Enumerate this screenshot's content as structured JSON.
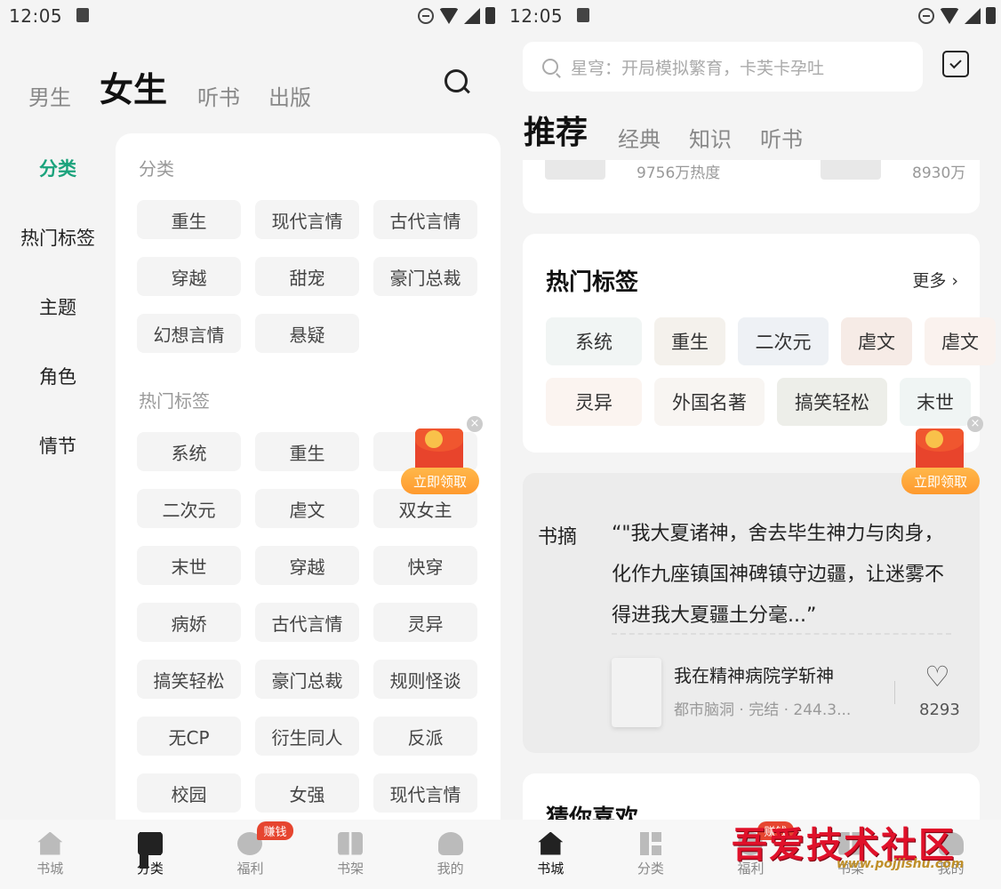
{
  "status_bar": {
    "time": "12:05"
  },
  "left": {
    "top_tabs": [
      "男生",
      "女生",
      "听书",
      "出版"
    ],
    "sidebar": [
      "分类",
      "热门标签",
      "主题",
      "角色",
      "情节"
    ],
    "section1": {
      "title": "分类",
      "tags": [
        "重生",
        "现代言情",
        "古代言情",
        "穿越",
        "甜宠",
        "豪门总裁",
        "幻想言情",
        "悬疑"
      ]
    },
    "section2": {
      "title": "热门标签",
      "tags": [
        "系统",
        "重生",
        "双",
        "二次元",
        "虐文",
        "双女主",
        "末世",
        "穿越",
        "快穿",
        "病娇",
        "古代言情",
        "灵异",
        "搞笑轻松",
        "豪门总裁",
        "规则怪谈",
        "无CP",
        "衍生同人",
        "反派",
        "校园",
        "女强",
        "现代言情"
      ]
    },
    "redpacket": {
      "label": "立即领取",
      "close": "×"
    },
    "tabbar": [
      {
        "label": "书城",
        "icon": "home-icon"
      },
      {
        "label": "分类",
        "icon": "category-icon"
      },
      {
        "label": "福利",
        "icon": "coin-icon",
        "badge": "赚钱"
      },
      {
        "label": "书架",
        "icon": "bookshelf-icon"
      },
      {
        "label": "我的",
        "icon": "user-icon"
      }
    ]
  },
  "right": {
    "search": {
      "placeholder": "星穹：开局模拟繁育，卡芙卡孕吐"
    },
    "top_tabs": [
      "推荐",
      "经典",
      "知识",
      "听书"
    ],
    "rank": {
      "heat1": "9756万热度",
      "heat2": "8930万"
    },
    "hot": {
      "title": "热门标签",
      "more": "更多 ›",
      "row1": [
        "系统",
        "重生",
        "二次元",
        "虐文",
        "虐文"
      ],
      "row2": [
        "灵异",
        "外国名著",
        "搞笑轻松",
        "末世"
      ]
    },
    "excerpt": {
      "label": "书摘",
      "quote": "“\"我大夏诸神，舍去毕生神力与肉身，化作九座镇国神碑镇守边疆，让迷雾不得进我大夏疆土分毫...”",
      "book_title": "我在精神病院学斩神",
      "book_meta": "都市脑洞 · 完结 · 244.3...",
      "likes": "8293"
    },
    "guess_title": "猜你喜欢",
    "tabbar": [
      {
        "label": "书城",
        "icon": "home-icon"
      },
      {
        "label": "分类",
        "icon": "category-icon"
      },
      {
        "label": "福利",
        "icon": "coin-icon",
        "badge": "赚钱"
      },
      {
        "label": "书架",
        "icon": "bookshelf-icon"
      },
      {
        "label": "我的",
        "icon": "user-icon"
      }
    ],
    "redpacket": {
      "label": "立即领取",
      "close": "×"
    }
  },
  "watermark": {
    "title": "吾爱技术社区",
    "url": "www.pojjishu.com"
  },
  "colors": {
    "accent_green": "#1ba37c",
    "badge_red": "#e6452f",
    "redpack_orange": "#ff9a2e"
  }
}
